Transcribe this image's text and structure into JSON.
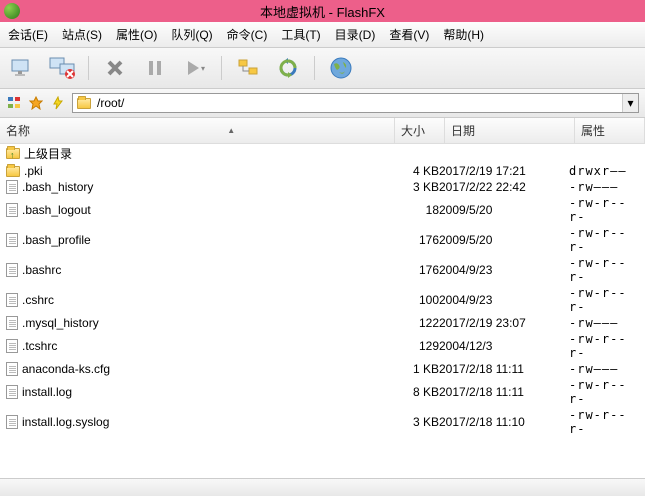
{
  "title": "本地虚拟机 - FlashFX",
  "menu": [
    "会话(E)",
    "站点(S)",
    "属性(O)",
    "队列(Q)",
    "命令(C)",
    "工具(T)",
    "目录(D)",
    "查看(V)",
    "帮助(H)"
  ],
  "path": "/root/",
  "columns": {
    "name": "名称",
    "size": "大小",
    "date": "日期",
    "attr": "属性"
  },
  "parent_dir": "上级目录",
  "rows": [
    {
      "icon": "folder",
      "name": ".pki",
      "size": "4 KB",
      "date": "2017/2/19 17:21",
      "attr": "drwxr——"
    },
    {
      "icon": "file",
      "name": ".bash_history",
      "size": "3 KB",
      "date": "2017/2/22 22:42",
      "attr": "-rw———"
    },
    {
      "icon": "file",
      "name": ".bash_logout",
      "size": "18",
      "date": "2009/5/20",
      "attr": "-rw-r--r-"
    },
    {
      "icon": "file",
      "name": ".bash_profile",
      "size": "176",
      "date": "2009/5/20",
      "attr": "-rw-r--r-"
    },
    {
      "icon": "file",
      "name": ".bashrc",
      "size": "176",
      "date": "2004/9/23",
      "attr": "-rw-r--r-"
    },
    {
      "icon": "file",
      "name": ".cshrc",
      "size": "100",
      "date": "2004/9/23",
      "attr": "-rw-r--r-"
    },
    {
      "icon": "file",
      "name": ".mysql_history",
      "size": "122",
      "date": "2017/2/19 23:07",
      "attr": "-rw———"
    },
    {
      "icon": "file",
      "name": ".tcshrc",
      "size": "129",
      "date": "2004/12/3",
      "attr": "-rw-r--r-"
    },
    {
      "icon": "file",
      "name": "anaconda-ks.cfg",
      "size": "1 KB",
      "date": "2017/2/18 11:11",
      "attr": "-rw———"
    },
    {
      "icon": "file",
      "name": "install.log",
      "size": "8 KB",
      "date": "2017/2/18 11:11",
      "attr": "-rw-r--r-"
    },
    {
      "icon": "file",
      "name": "install.log.syslog",
      "size": "3 KB",
      "date": "2017/2/18 11:10",
      "attr": "-rw-r--r-"
    }
  ]
}
